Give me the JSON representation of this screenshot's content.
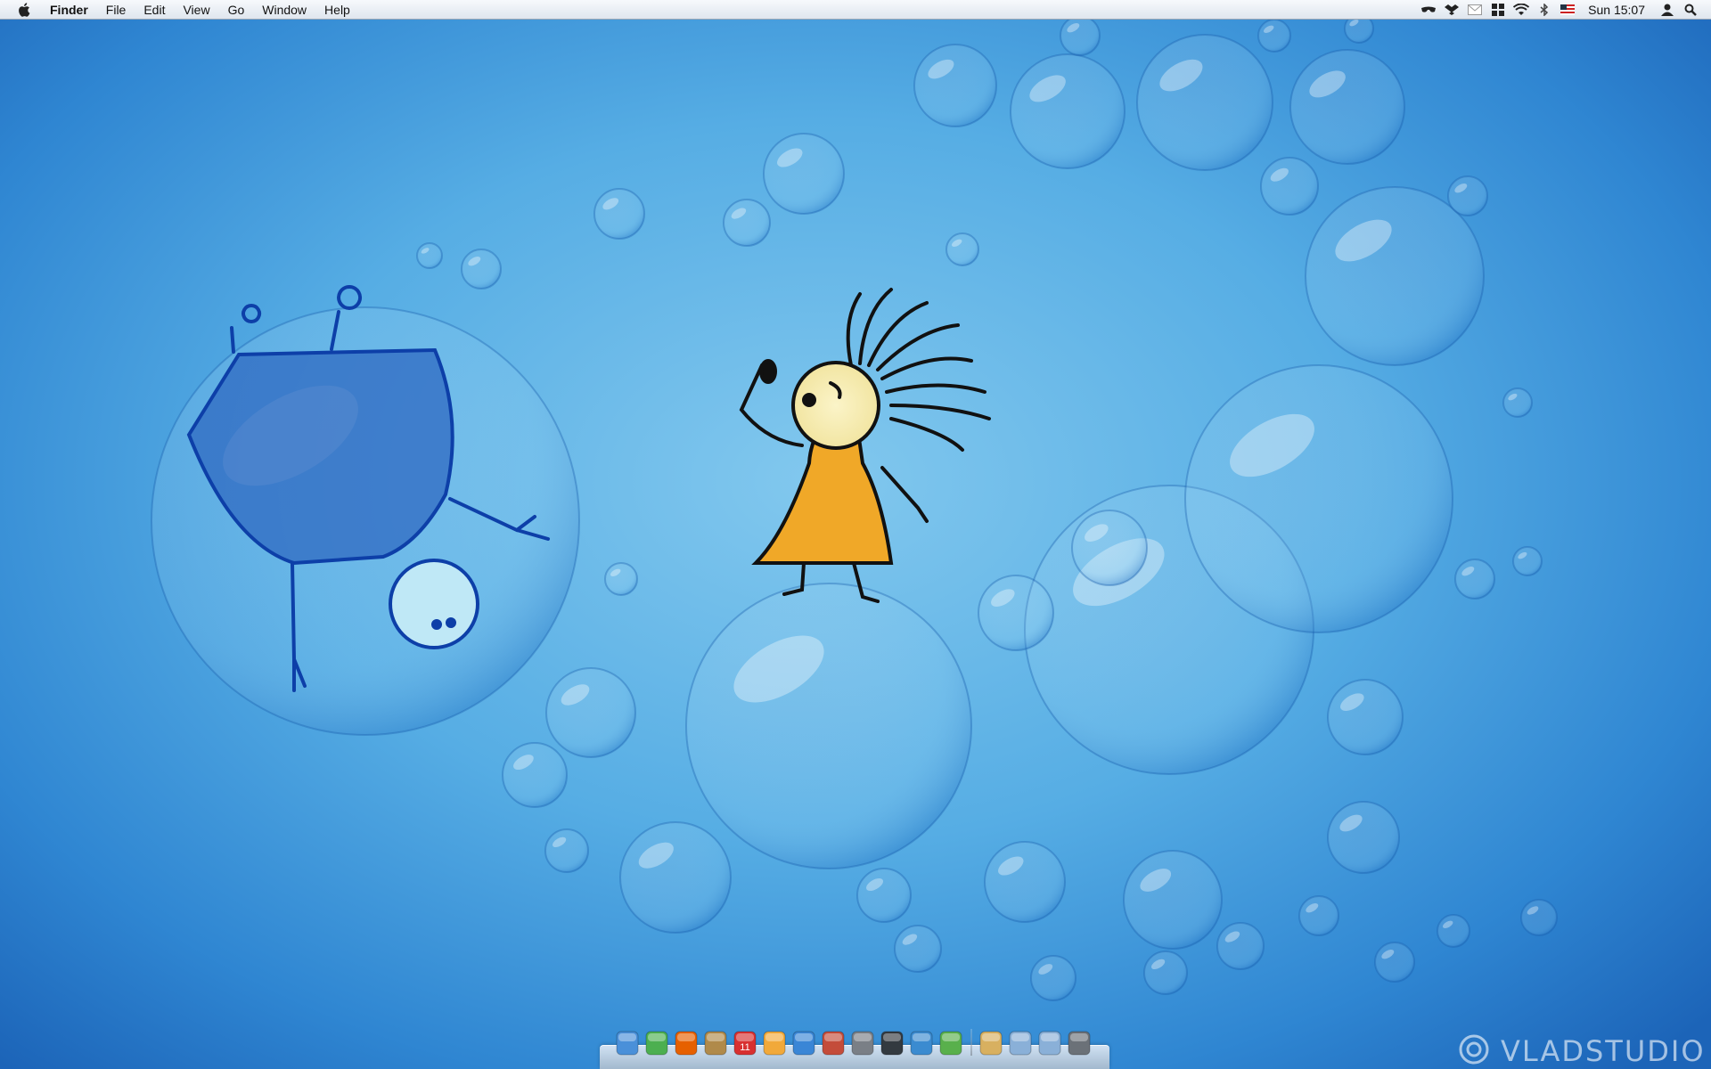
{
  "menubar": {
    "app_name": "Finder",
    "menus": [
      "File",
      "Edit",
      "View",
      "Go",
      "Window",
      "Help"
    ],
    "status_icons": [
      "spy-glasses-icon",
      "dropbox-icon",
      "mail-icon",
      "grid-app-icon",
      "wifi-icon",
      "bluetooth-icon",
      "flag-input-icon"
    ],
    "clock": "Sun 15:07",
    "user_icon": "user-icon",
    "search_icon": "spotlight-icon"
  },
  "dock": {
    "apps": [
      {
        "name": "finder-icon",
        "color": "#4a90d9"
      },
      {
        "name": "uploader-icon",
        "color": "#4caf50"
      },
      {
        "name": "firefox-icon",
        "color": "#e66000"
      },
      {
        "name": "library-icon",
        "color": "#b08a4a"
      },
      {
        "name": "calendar-icon",
        "color": "#d83030",
        "label": "11"
      },
      {
        "name": "iphoto-icon",
        "color": "#f1a93a"
      },
      {
        "name": "itunes-icon",
        "color": "#3a86d6"
      },
      {
        "name": "textedit-icon",
        "color": "#c44c3a"
      },
      {
        "name": "preferences-icon",
        "color": "#7a7f86"
      },
      {
        "name": "pen-tool-icon",
        "color": "#333a40"
      },
      {
        "name": "chart-app-icon",
        "color": "#3b8bd0"
      },
      {
        "name": "leaf-app-icon",
        "color": "#59b04c"
      }
    ],
    "stack": [
      {
        "name": "document-stack-icon",
        "color": "#d8b060"
      },
      {
        "name": "folder-icon",
        "color": "#8ab0d8"
      },
      {
        "name": "downloads-folder-icon",
        "color": "#8ab0d8"
      },
      {
        "name": "trash-icon",
        "color": "#6b7178"
      }
    ]
  },
  "watermark": "VLADSTUDIO",
  "colors": {
    "desktop": "#56ade4",
    "menubar": "#e8edf3",
    "girl_dress": "#f0a828",
    "creature": "#2f6ac2"
  }
}
